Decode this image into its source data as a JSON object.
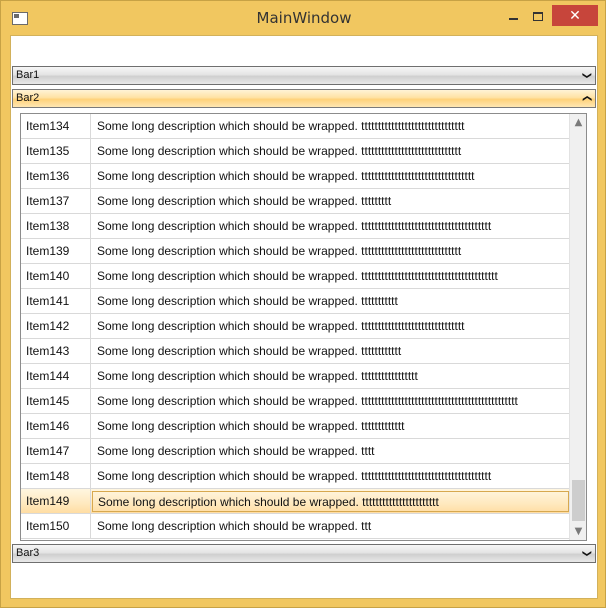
{
  "window": {
    "title": "MainWindow",
    "icons": {
      "app": "window-app-icon",
      "minimize": "minimize-icon",
      "maximize": "maximize-icon",
      "close": "close-icon"
    },
    "colors": {
      "frame": "#f1c760",
      "close_button": "#c7453b",
      "selected_row": "#ffe2a3"
    }
  },
  "expanders": [
    {
      "label": "Bar1",
      "expanded": false,
      "arrow_icon": "chevron-down-icon"
    },
    {
      "label": "Bar2",
      "expanded": true,
      "arrow_icon": "chevron-up-icon"
    },
    {
      "label": "Bar3",
      "expanded": false,
      "arrow_icon": "chevron-down-icon"
    }
  ],
  "list": {
    "selected_index": 15,
    "items": [
      {
        "name": "Item134",
        "description": "Some long description which should be wrapped. ttttttttttttttttttttttttttttttt"
      },
      {
        "name": "Item135",
        "description": "Some long description which should be wrapped. tttttttttttttttttttttttttttttt"
      },
      {
        "name": "Item136",
        "description": "Some long description which should be wrapped. tttttttttttttttttttttttttttttttttt"
      },
      {
        "name": "Item137",
        "description": "Some long description which should be wrapped. ttttttttt"
      },
      {
        "name": "Item138",
        "description": "Some long description which should be wrapped. ttttttttttttttttttttttttttttttttttttttt"
      },
      {
        "name": "Item139",
        "description": "Some long description which should be wrapped. tttttttttttttttttttttttttttttt"
      },
      {
        "name": "Item140",
        "description": "Some long description which should be wrapped. ttttttttttttttttttttttttttttttttttttttttt"
      },
      {
        "name": "Item141",
        "description": "Some long description which should be wrapped. ttttttttttt"
      },
      {
        "name": "Item142",
        "description": "Some long description which should be wrapped. ttttttttttttttttttttttttttttttt"
      },
      {
        "name": "Item143",
        "description": "Some long description which should be wrapped. tttttttttttt"
      },
      {
        "name": "Item144",
        "description": "Some long description which should be wrapped. ttttttttttttttttt"
      },
      {
        "name": "Item145",
        "description": "Some long description which should be wrapped. ttttttttttttttttttttttttttttttttttttttttttttttt"
      },
      {
        "name": "Item146",
        "description": "Some long description which should be wrapped. ttttttttttttt"
      },
      {
        "name": "Item147",
        "description": "Some long description which should be wrapped. tttt"
      },
      {
        "name": "Item148",
        "description": "Some long description which should be wrapped. ttttttttttttttttttttttttttttttttttttttt"
      },
      {
        "name": "Item149",
        "description": "Some long description which should be wrapped. ttttttttttttttttttttttt"
      },
      {
        "name": "Item150",
        "description": "Some long description which should be wrapped. ttt"
      }
    ]
  },
  "scrollbar": {
    "up_icon": "scroll-up-icon",
    "down_icon": "scroll-down-icon",
    "position": 0.98
  }
}
